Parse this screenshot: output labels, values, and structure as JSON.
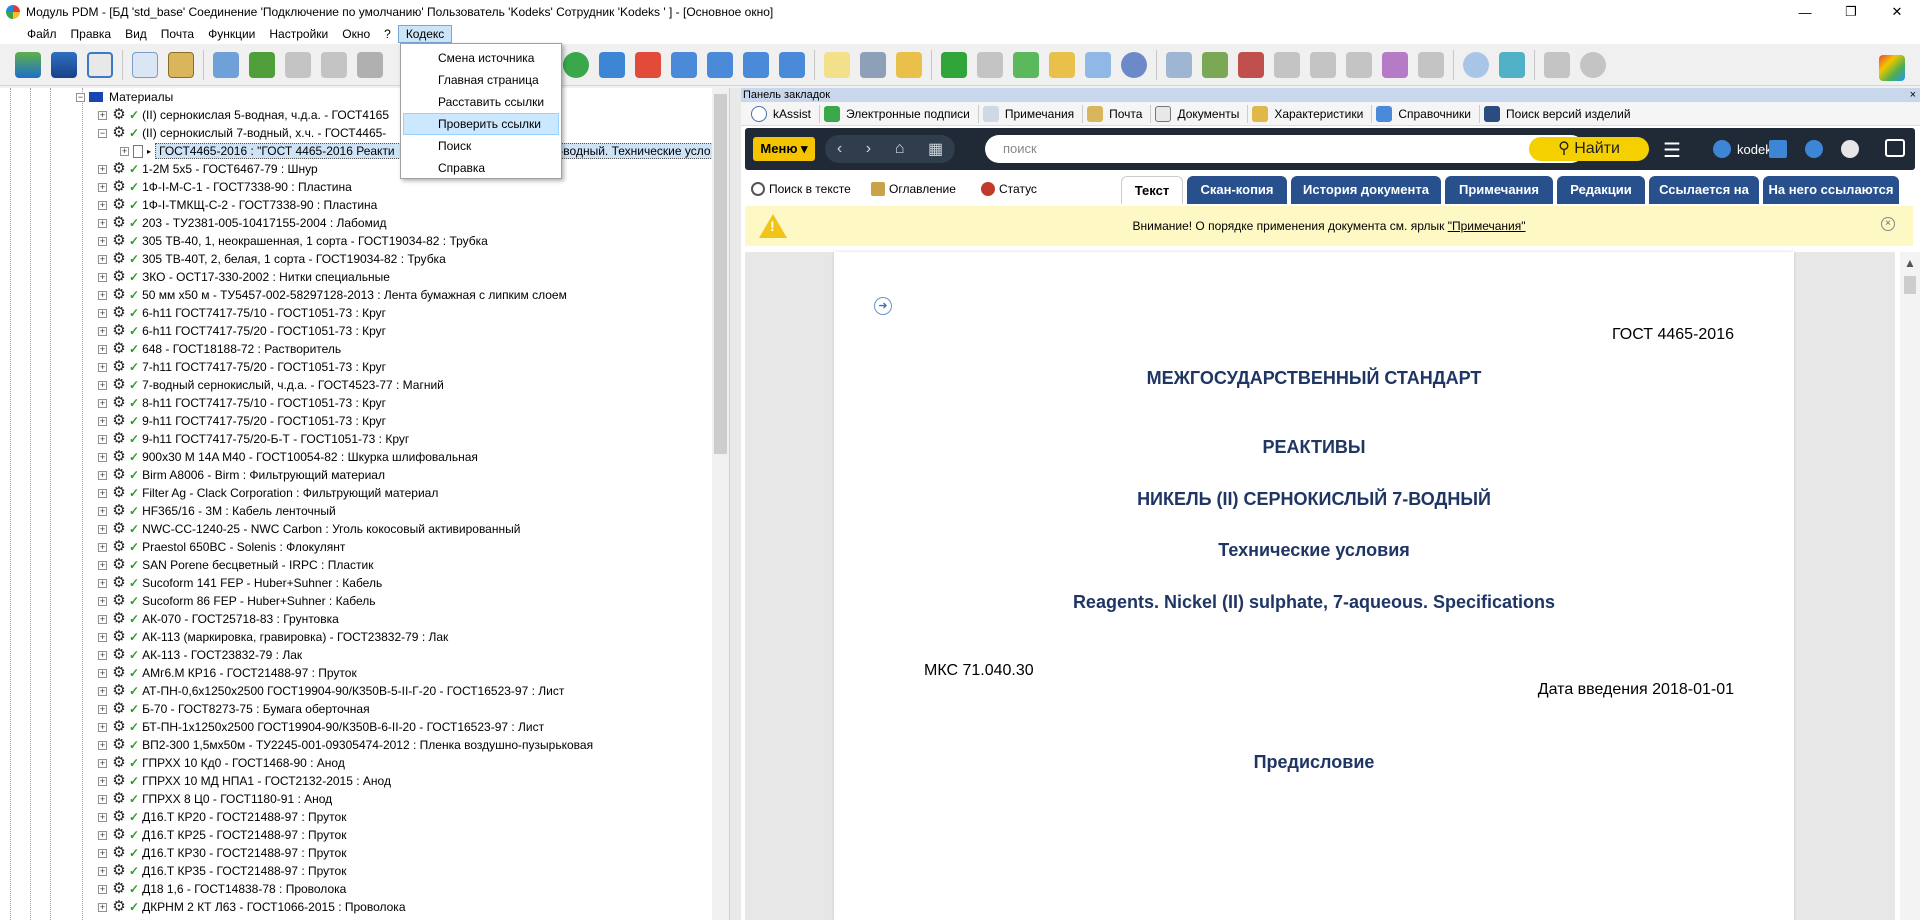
{
  "window": {
    "title": "Модуль PDM - [БД 'std_base' Соединение 'Подключение по умолчанию' Пользователь 'Kodeks' Сотрудник 'Kodeks ' ] - [Основное окно]",
    "min": "—",
    "max": "❐",
    "close": "✕"
  },
  "menubar": [
    "Файл",
    "Правка",
    "Вид",
    "Почта",
    "Функции",
    "Настройки",
    "Окно",
    "?",
    "Кодекс"
  ],
  "dropdown": [
    "Смена источника",
    "Главная страница",
    "Расставить ссылки",
    "Проверить ссылки",
    "Поиск",
    "Справка"
  ],
  "tree": {
    "root": "Материалы",
    "top_items": [
      "(II) сернокислая 5-водная, ч.д.а. - ГОСТ4165",
      "(II) сернокислый 7-водный, х.ч. - ГОСТ4465-"
    ],
    "selected": "ГОСТ4465-2016 : \"ГОСТ 4465-2016 Реакти",
    "selected_tail": "7-водный. Технические усло",
    "items": [
      "1-2М 5х5 - ГОСТ6467-79 : Шнур",
      "1Ф-I-М-С-1 - ГОСТ7338-90 : Пластина",
      "1Ф-I-ТМКЩ-С-2 - ГОСТ7338-90 : Пластина",
      "203 - ТУ2381-005-10417155-2004 : Лабомид",
      "305 ТВ-40, 1, неокрашенная, 1 сорта - ГОСТ19034-82 : Трубка",
      "305 ТВ-40Т, 2, белая, 1 сорта - ГОСТ19034-82 : Трубка",
      "ЗКО - ОСТ17-330-2002 : Нитки специальные",
      "50 мм х50 м - ТУ5457-002-58297128-2013 : Лента бумажная с липким слоем",
      "6-h11 ГОСТ7417-75/10 - ГОСТ1051-73 : Круг",
      "6-h11 ГОСТ7417-75/20 - ГОСТ1051-73 : Круг",
      "648 - ГОСТ18188-72 : Растворитель",
      "7-h11 ГОСТ7417-75/20 - ГОСТ1051-73 : Круг",
      "7-водный сернокислый, ч.д.а. - ГОСТ4523-77 : Магний",
      "8-h11 ГОСТ7417-75/10 - ГОСТ1051-73 : Круг",
      "9-h11 ГОСТ7417-75/20 - ГОСТ1051-73 : Круг",
      "9-h11 ГОСТ7417-75/20-Б-Т - ГОСТ1051-73 : Круг",
      "900х30 M 14A M40 - ГОСТ10054-82 : Шкурка шлифовальная",
      "Birm A8006 - Birm : Фильтрующий материал",
      "Filter Ag - Clack Corporation : Фильтрующий материал",
      "HF365/16 - 3M : Кабель ленточный",
      "NWC-CC-1240-25 - NWC Carbon : Уголь кокосовый активированный",
      "Praestol 650BC - Solenis : Флокулянт",
      "SAN Porene бесцветный - IRPC : Пластик",
      "Sucoform 141 FEP - Huber+Suhner : Кабель",
      "Sucoform 86 FEP - Huber+Suhner : Кабель",
      "АК-070 - ГОСТ25718-83 : Грунтовка",
      "АК-113 (маркировка, гравировка) - ГОСТ23832-79 : Лак",
      "АК-113 - ГОСТ23832-79 : Лак",
      "АМг6.М КР16 - ГОСТ21488-97 : Пруток",
      "АТ-ПН-0,6х1250х2500 ГОСТ19904-90/К350В-5-II-Г-20 - ГОСТ16523-97 : Лист",
      "Б-70 - ГОСТ8273-75 : Бумага оберточная",
      "БТ-ПН-1х1250х2500 ГОСТ19904-90/К350В-6-II-20 - ГОСТ16523-97 : Лист",
      "ВП2-300 1,5мх50м - ТУ2245-001-09305474-2012 : Пленка воздушно-пузырьковая",
      "ГПРХХ 10 Кд0 - ГОСТ1468-90 : Анод",
      "ГПРХХ 10 МД НПА1 - ГОСТ2132-2015 : Анод",
      "ГПРХХ 8 Ц0 - ГОСТ1180-91 : Анод",
      "Д16.Т КР20 - ГОСТ21488-97 : Пруток",
      "Д16.Т КР25 - ГОСТ21488-97 : Пруток",
      "Д16.Т КР30 - ГОСТ21488-97 : Пруток",
      "Д16.Т КР35 - ГОСТ21488-97 : Пруток",
      "Д18 1,6 - ГОСТ14838-78 : Проволока",
      "ДКРНМ 2 КТ Л63 - ГОСТ1066-2015 : Проволока"
    ]
  },
  "panel": {
    "title": "Панель закладок",
    "close": "×",
    "bookmarks": [
      "kAssist",
      "Электронные подписи",
      "Примечания",
      "Почта",
      "Документы",
      "Характеристики",
      "Справочники",
      "Поиск версий изделий"
    ]
  },
  "kodeks": {
    "menu": "Меню ▾",
    "search_placeholder": "поиск",
    "find": "Найти",
    "user": "kodeks"
  },
  "doc_tools": [
    "Поиск в тексте",
    "Оглавление",
    "Статус"
  ],
  "doc_tabs": [
    "Текст",
    "Скан-копия",
    "История документа",
    "Примечания",
    "Редакции",
    "Ссылается на",
    "На него ссылаются"
  ],
  "notice": {
    "text": "Внимание! О порядке применения документа см. ярлык ",
    "link": "\"Примечания\""
  },
  "document": {
    "code": "ГОСТ 4465-2016",
    "h1": "МЕЖГОСУДАРСТВЕННЫЙ СТАНДАРТ",
    "h2": "РЕАКТИВЫ",
    "h3": "НИКЕЛЬ (II) СЕРНОКИСЛЫЙ 7-ВОДНЫЙ",
    "h4": "Технические условия",
    "h5": "Reagents. Nickel (II) sulphate, 7-aqueous. Specifications",
    "mks": "МКС 71.040.30",
    "date": "Дата введения 2018-01-01",
    "preface": "Предисловие"
  }
}
